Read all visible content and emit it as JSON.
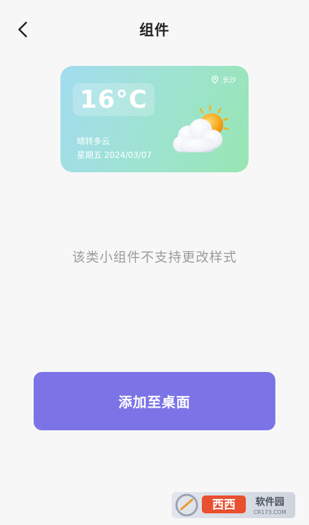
{
  "header": {
    "title": "组件",
    "back_icon": "chevron-left-icon"
  },
  "widget": {
    "location": "长沙",
    "location_icon": "location-pin-icon",
    "temperature": "16°C",
    "condition": "晴转多云",
    "date": "星期五 2024/03/07",
    "illustration": "partly-cloudy-icon",
    "colors": {
      "gradient_start": "#a3dcef",
      "gradient_end": "#97e6b3",
      "text": "#ffffff"
    }
  },
  "notice": "该类小组件不支持更改样式",
  "actions": {
    "add_to_desktop_label": "添加至桌面"
  },
  "watermark": {
    "brand": "西西软件园",
    "site": "CR173.COM"
  },
  "colors": {
    "background": "#f7f7f7",
    "accent": "#7c74e6",
    "notice_text": "#9b9b9b"
  }
}
